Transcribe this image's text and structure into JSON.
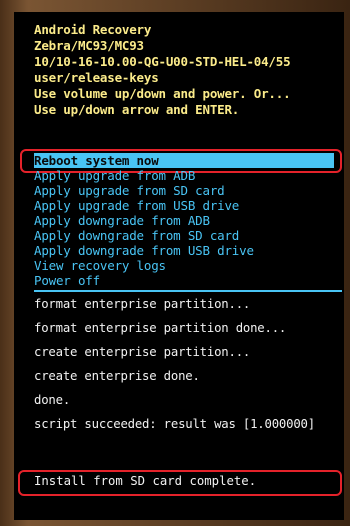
{
  "header": {
    "lines": [
      "Android Recovery",
      "Zebra/MC93/MC93",
      "10/10-16-10.00-QG-U00-STD-HEL-04/55",
      "user/release-keys",
      "Use volume up/down and power. Or...",
      "Use up/down arrow and ENTER."
    ]
  },
  "menu": {
    "items": [
      {
        "label": "Reboot system now",
        "selected": true
      },
      {
        "label": "Apply upgrade from ADB"
      },
      {
        "label": "Apply upgrade from SD card"
      },
      {
        "label": "Apply upgrade from USB drive"
      },
      {
        "label": "Apply downgrade from ADB"
      },
      {
        "label": "Apply downgrade from SD card"
      },
      {
        "label": "Apply downgrade from USB drive"
      },
      {
        "label": "View recovery logs"
      },
      {
        "label": "Power off"
      }
    ]
  },
  "log": {
    "lines": [
      "format enterprise partition...",
      "format enterprise partition done...",
      "create enterprise partition...",
      "create enterprise done.",
      "done.",
      "script succeeded: result was [1.000000]"
    ]
  },
  "status": {
    "message": "Install from SD card complete."
  },
  "colors": {
    "header_text": "#fbeb8a",
    "menu_text": "#49c4f4",
    "selection_bg": "#49c4f4",
    "log_text": "#f2f2f2",
    "annotation_box": "#e4222a",
    "screen_bg": "#000000"
  }
}
